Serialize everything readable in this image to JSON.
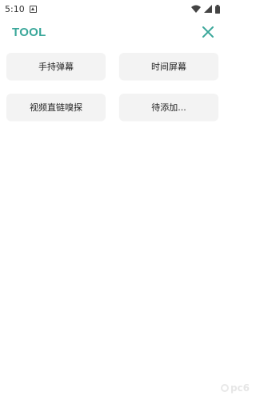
{
  "status_bar": {
    "time": "5:10",
    "icons": [
      "notification-icon",
      "wifi-icon",
      "signal-icon",
      "battery-icon"
    ]
  },
  "header": {
    "title": "TOOL",
    "close_icon": "close-icon",
    "accent_color": "#3aa79a"
  },
  "tools": [
    {
      "label": "手持弹幕"
    },
    {
      "label": "时间屏幕"
    },
    {
      "label": "视频直链嗅探"
    },
    {
      "label": "待添加..."
    }
  ],
  "watermark": {
    "text": "pc6"
  }
}
